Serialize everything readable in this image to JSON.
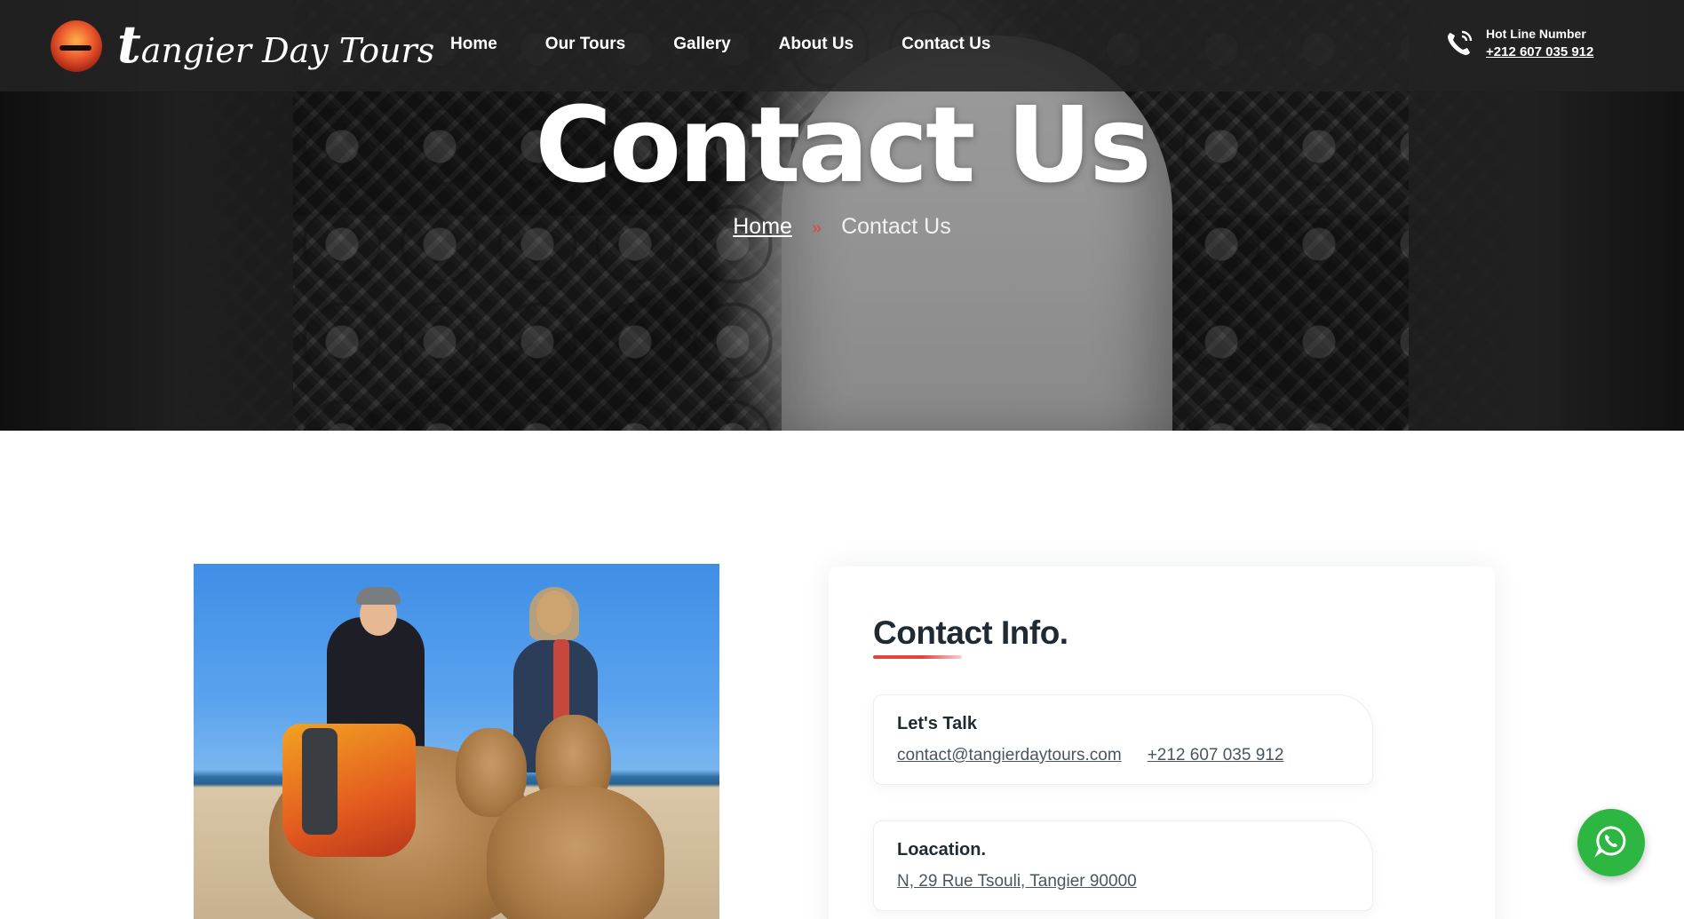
{
  "header": {
    "logo_text": "tangier Day Tours",
    "logo_initial": "t",
    "logo_rest": "angier Day Tours",
    "nav": [
      {
        "label": "Home"
      },
      {
        "label": "Our Tours"
      },
      {
        "label": "Gallery"
      },
      {
        "label": "About Us"
      },
      {
        "label": "Contact Us"
      }
    ],
    "hotline_label": "Hot Line Number",
    "hotline_number": "+212 607 035 912"
  },
  "hero": {
    "title": "Contact Us",
    "breadcrumb": {
      "home": "Home",
      "separator": "»",
      "current": "Contact Us"
    }
  },
  "contact_card": {
    "title": "Contact Info.",
    "talk": {
      "heading": "Let's Talk",
      "email": "contact@tangierdaytours.com",
      "phone": "+212 607 035 912"
    },
    "location": {
      "heading": "Loacation.",
      "address": "N, 29 Rue Tsouli, Tangier 90000"
    }
  },
  "colors": {
    "accent": "#e0443b",
    "header_bg": "#232323",
    "text_dark": "#1f2a33",
    "whatsapp": "#2db742"
  },
  "icons": {
    "phone": "phone-ring-icon",
    "whatsapp": "whatsapp-icon"
  }
}
